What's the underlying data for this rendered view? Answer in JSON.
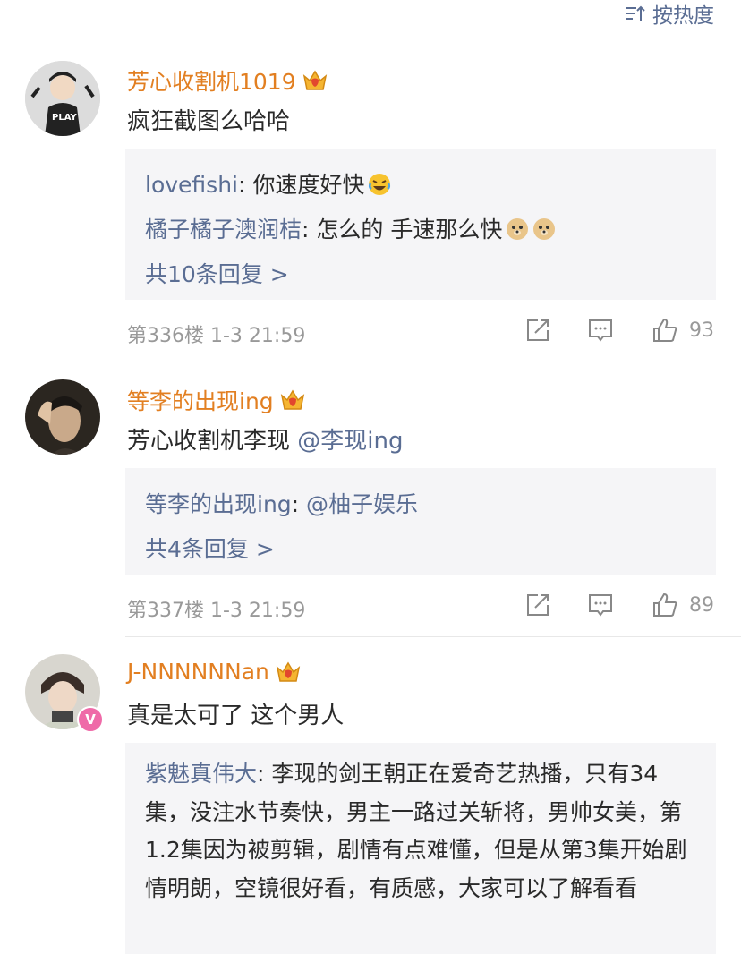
{
  "sort": {
    "label": "按热度"
  },
  "comments": [
    {
      "username": "芳心收割机1019",
      "text": "疯狂截图么哈哈",
      "replies": [
        {
          "name": "lovefishi",
          "sep": ": ",
          "text": "你速度好快",
          "emoji": "laughing-tears-emoji"
        },
        {
          "name": "橘子橘子澳润桔",
          "sep": ": ",
          "text": "怎么的 手速那么快",
          "emoji": "doge-emoji"
        }
      ],
      "more_replies": "共10条回复 >",
      "meta": "第336楼 1-3 21:59",
      "likes": "93"
    },
    {
      "username": "等李的出现ing",
      "text": "芳心收割机李现 ",
      "mention": "@李现ing",
      "replies": [
        {
          "name": "等李的出现ing",
          "sep": ": ",
          "text": "",
          "mention": "@柚子娱乐"
        }
      ],
      "more_replies": "共4条回复 >",
      "meta": "第337楼 1-3 21:59",
      "likes": "89"
    },
    {
      "username": "J-NNNNNNan",
      "text": "真是太可了 这个男人",
      "replies": [
        {
          "name": "紫魅真伟大",
          "sep": ": ",
          "text": "李现的剑王朝正在爱奇艺热播，只有34集，没注水节奏快，男主一路过关斩将，男帅女美，第1.2集因为被剪辑，剧情有点难懂，但是从第3集开始剧情明朗，空镜很好看，有质感，大家可以了解看看"
        }
      ]
    }
  ],
  "colors": {
    "username": "#e27f21",
    "link": "#5a6d93",
    "meta": "#999999",
    "reply_bg": "#f5f5f7"
  }
}
